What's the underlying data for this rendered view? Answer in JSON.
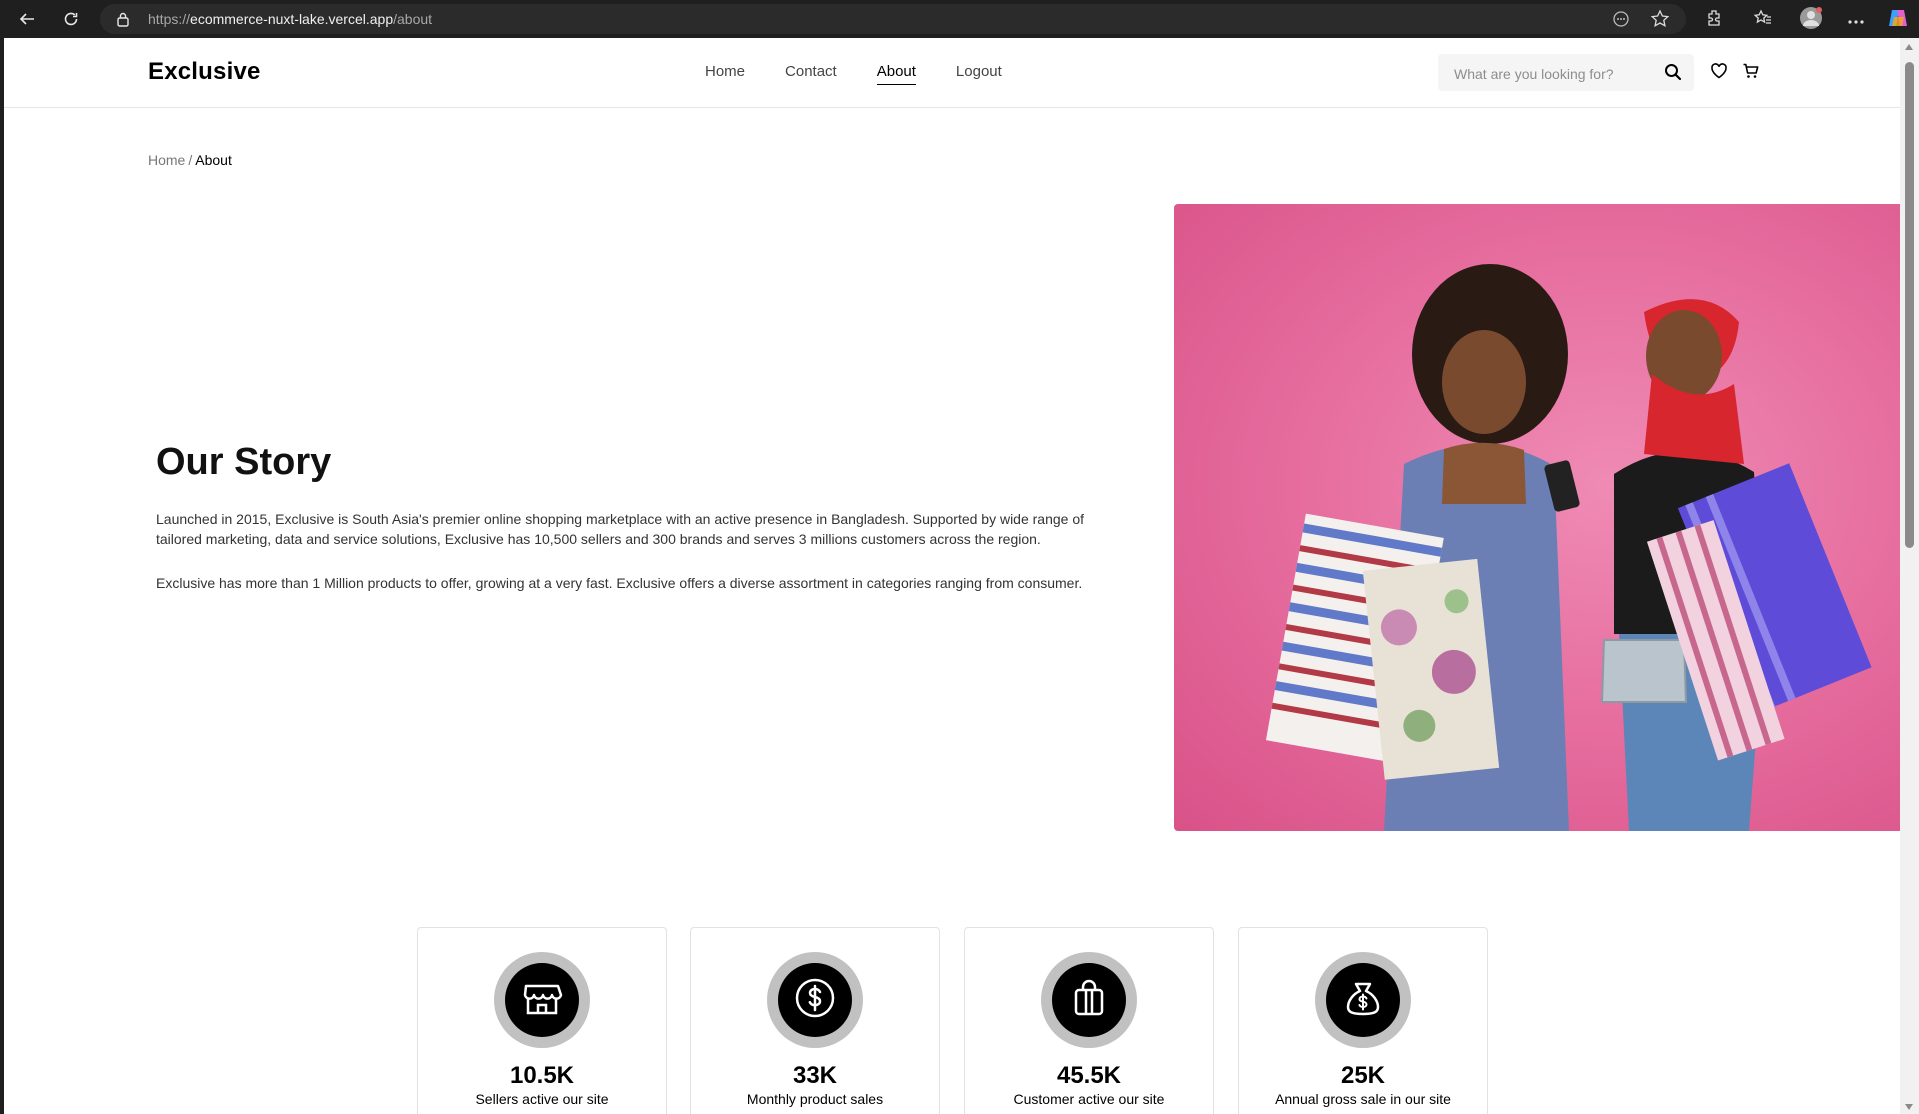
{
  "browser": {
    "url_prefix": "https://",
    "url_host": "ecommerce-nuxt-lake.vercel.app",
    "url_path": "/about"
  },
  "header": {
    "logo": "Exclusive",
    "nav": [
      {
        "label": "Home",
        "active": false
      },
      {
        "label": "Contact",
        "active": false
      },
      {
        "label": "About",
        "active": true
      },
      {
        "label": "Logout",
        "active": false
      }
    ],
    "search_placeholder": "What are you looking for?"
  },
  "breadcrumb": {
    "home": "Home",
    "separator": "/",
    "current": "About"
  },
  "story": {
    "title": "Our Story",
    "paragraph1": "Launched in 2015, Exclusive is South Asia's premier online shopping marketplace with an active presence in Bangladesh. Supported by wide range of tailored marketing, data and service solutions, Exclusive has 10,500 sellers and 300 brands and serves 3 millions customers across the region.",
    "paragraph2": "Exclusive has more than 1 Million products to offer, growing at a very fast. Exclusive offers a diverse assortment in categories ranging from consumer."
  },
  "stats": [
    {
      "icon": "shop-icon",
      "value": "10.5K",
      "label": "Sellers active our site"
    },
    {
      "icon": "dollar-icon",
      "value": "33K",
      "label": "Monthly product sales"
    },
    {
      "icon": "gift-bag-icon",
      "value": "45.5K",
      "label": "Customer active our site"
    },
    {
      "icon": "money-bag-icon",
      "value": "25K",
      "label": "Annual gross sale in our site"
    }
  ],
  "colors": {
    "hero_bg": "#e56a9c",
    "icon_ring": "#c1c1c1",
    "icon_inner": "#000000"
  }
}
